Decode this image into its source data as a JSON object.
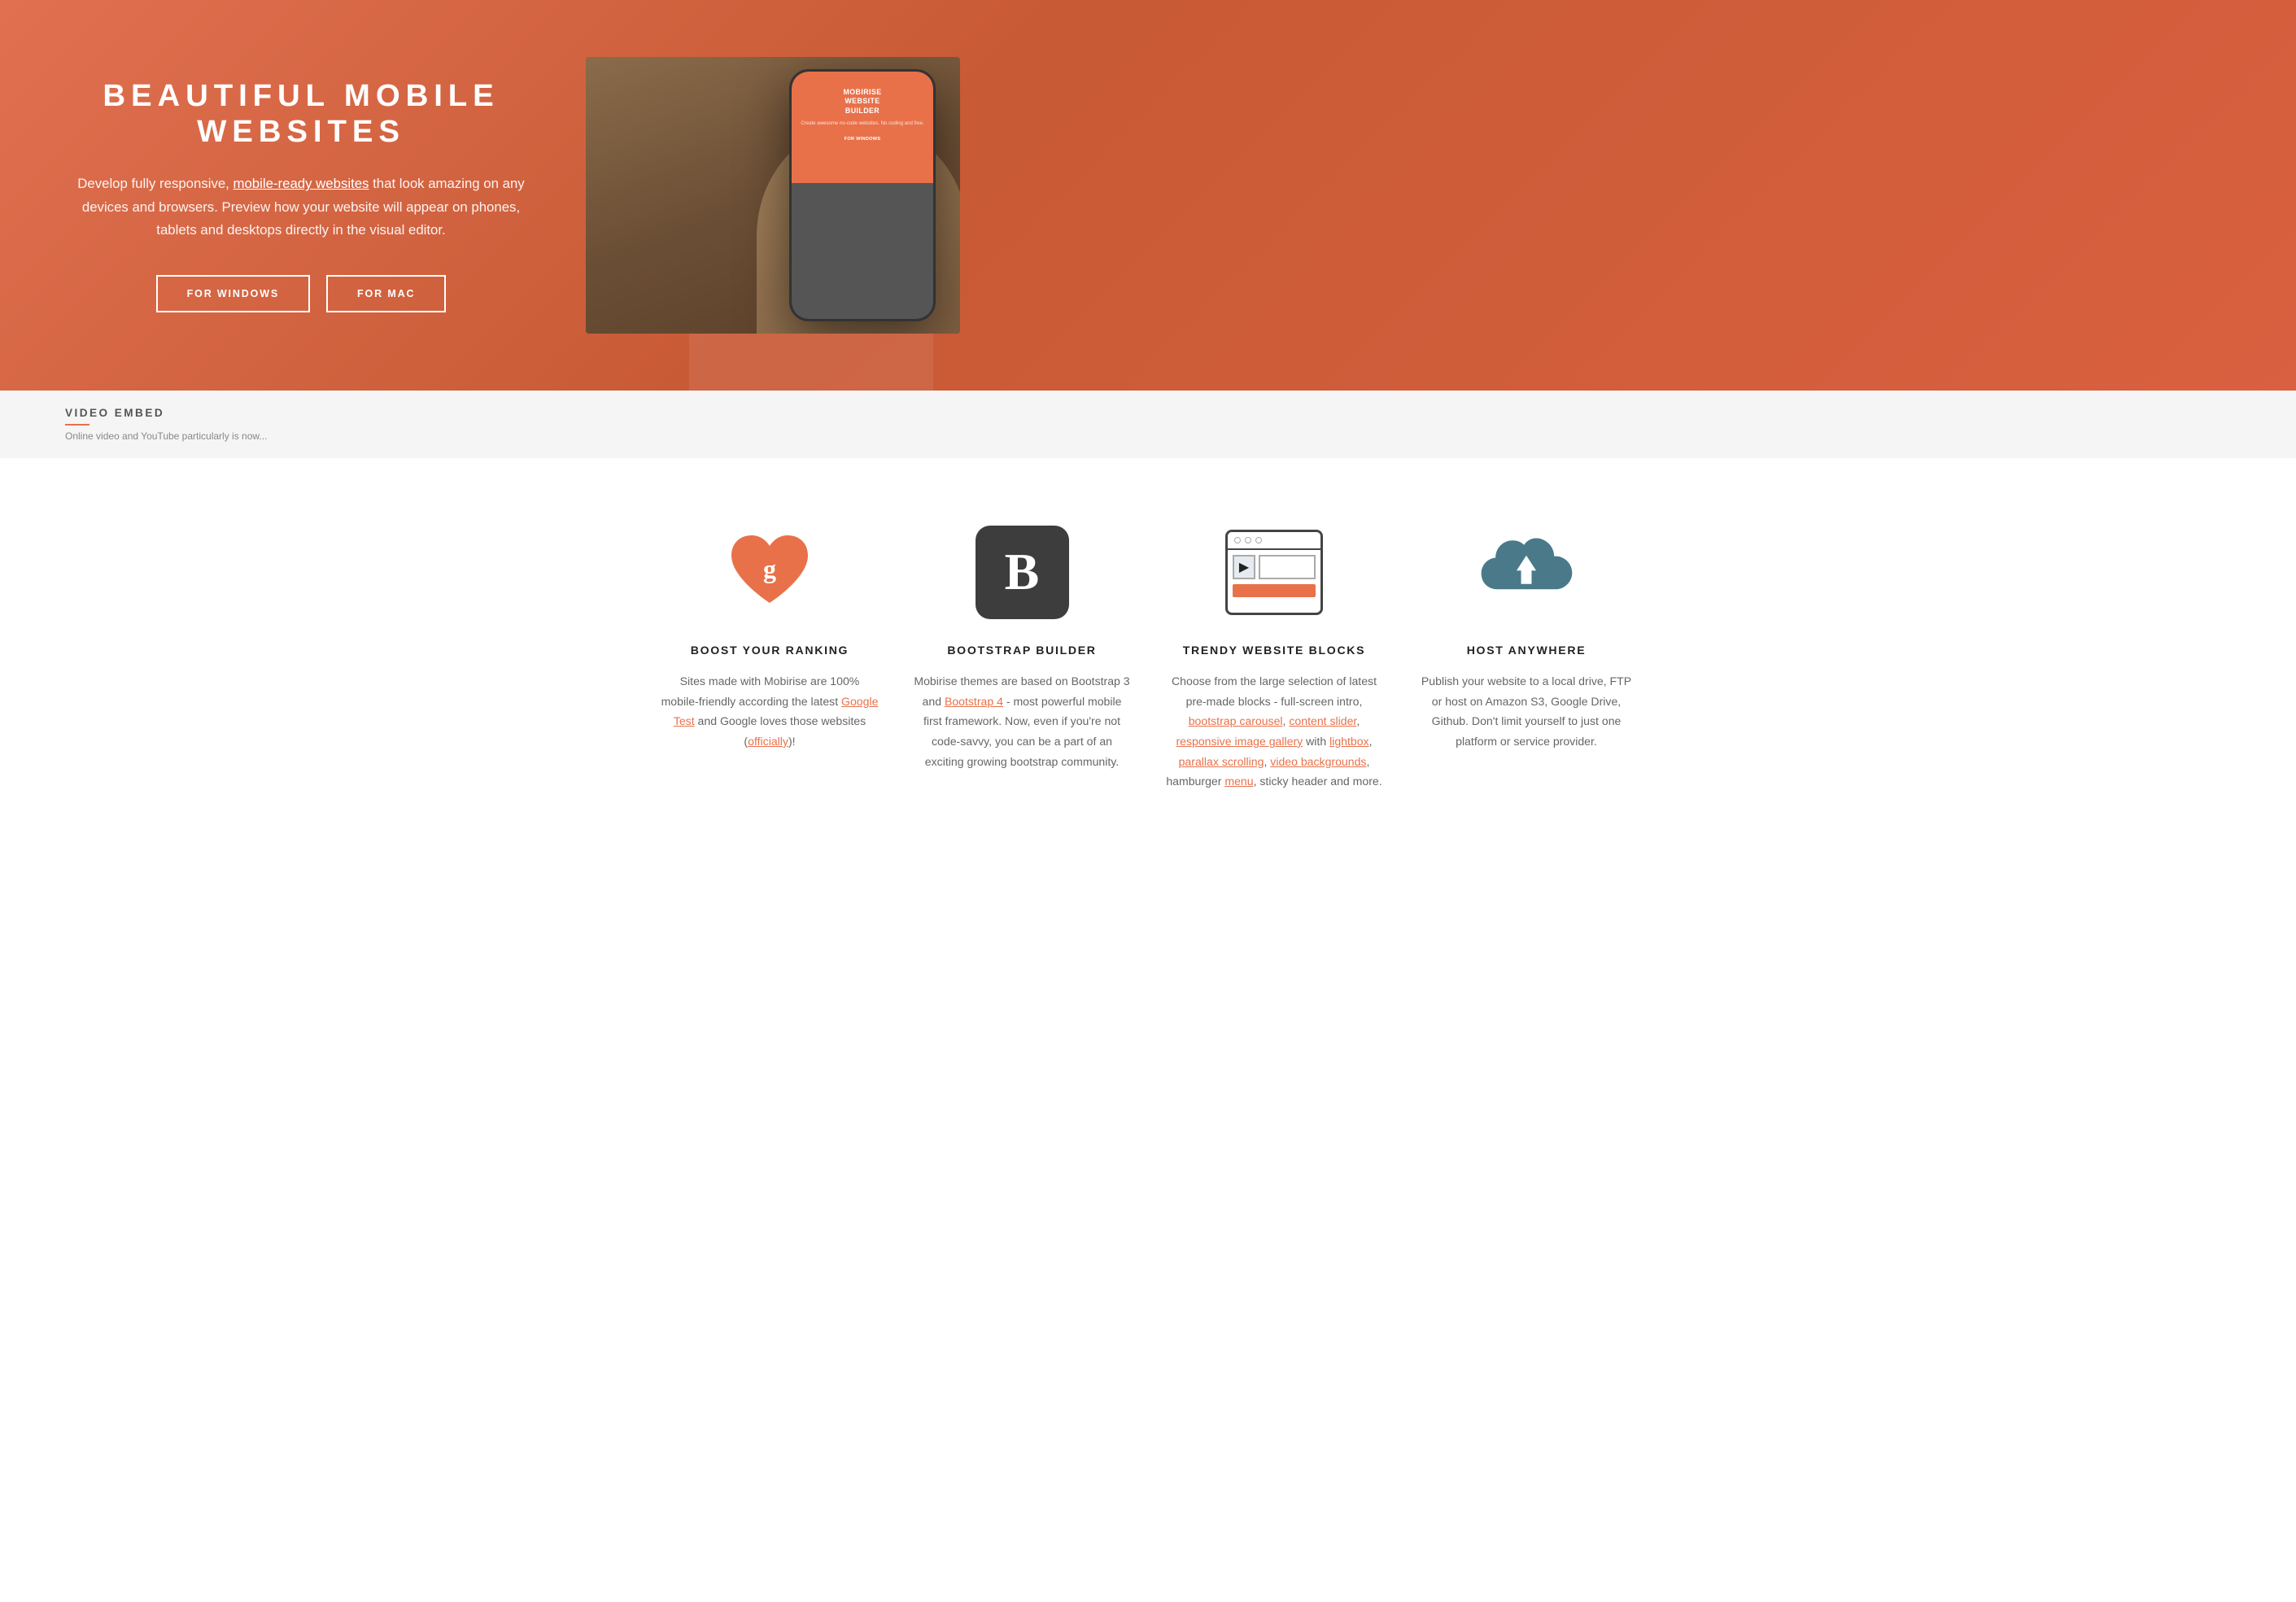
{
  "hero": {
    "title": "BEAUTIFUL MOBILE WEBSITES",
    "description_before_link": "Develop fully responsive, ",
    "description_link": "mobile-ready websites",
    "description_after_link": " that look amazing on any devices and browsers. Preview how your website will appear on phones, tablets and desktops directly in the visual editor.",
    "button_windows": "FOR WINDOWS",
    "button_mac": "FOR MAC",
    "phone_screen_title": "MOBIRISE\nWEBSITE\nBUILDER",
    "phone_screen_sub": "Create awesome no-code websites. No coding and free.",
    "phone_btn": "FOR WINDOWS"
  },
  "video_embed": {
    "label": "VIDEO EMBED",
    "text": "Online video and YouTube particularly is now..."
  },
  "features": [
    {
      "id": "boost",
      "icon_type": "heart",
      "title": "BOOST YOUR RANKING",
      "description_parts": [
        {
          "type": "text",
          "content": "Sites made with Mobirise are 100% mobile-friendly according the latest "
        },
        {
          "type": "link",
          "content": "Google Test"
        },
        {
          "type": "text",
          "content": " and Google loves those websites ("
        },
        {
          "type": "link",
          "content": "officially"
        },
        {
          "type": "text",
          "content": ")!"
        }
      ]
    },
    {
      "id": "bootstrap",
      "icon_type": "bootstrap",
      "title": "BOOTSTRAP BUILDER",
      "description_parts": [
        {
          "type": "text",
          "content": "Mobirise themes are based on Bootstrap 3 and "
        },
        {
          "type": "link",
          "content": "Bootstrap 4"
        },
        {
          "type": "text",
          "content": " - most powerful mobile first framework. Now, even if you're not code-savvy, you can be a part of an exciting growing bootstrap community."
        }
      ]
    },
    {
      "id": "trendy",
      "icon_type": "browser",
      "title": "TRENDY WEBSITE BLOCKS",
      "description_parts": [
        {
          "type": "text",
          "content": "Choose from the large selection of latest pre-made blocks - full-screen intro, "
        },
        {
          "type": "link",
          "content": "bootstrap carousel"
        },
        {
          "type": "text",
          "content": ", "
        },
        {
          "type": "link",
          "content": "content slider"
        },
        {
          "type": "text",
          "content": ", "
        },
        {
          "type": "link",
          "content": "responsive image gallery"
        },
        {
          "type": "text",
          "content": " with "
        },
        {
          "type": "link",
          "content": "lightbox"
        },
        {
          "type": "text",
          "content": ", "
        },
        {
          "type": "link",
          "content": "parallax scrolling"
        },
        {
          "type": "text",
          "content": ", "
        },
        {
          "type": "link",
          "content": "video backgrounds"
        },
        {
          "type": "text",
          "content": ", hamburger "
        },
        {
          "type": "link",
          "content": "menu"
        },
        {
          "type": "text",
          "content": ", sticky header and more."
        }
      ]
    },
    {
      "id": "host",
      "icon_type": "cloud",
      "title": "HOST ANYWHERE",
      "description_parts": [
        {
          "type": "text",
          "content": "Publish your website to a local drive, FTP or host on Amazon S3, Google Drive, Github. Don't limit yourself to just one platform or service provider."
        }
      ]
    }
  ],
  "colors": {
    "accent": "#e8714a",
    "dark": "#3d3d3d",
    "text": "#666666",
    "title": "#222222",
    "teal": "#4a7a8a"
  }
}
